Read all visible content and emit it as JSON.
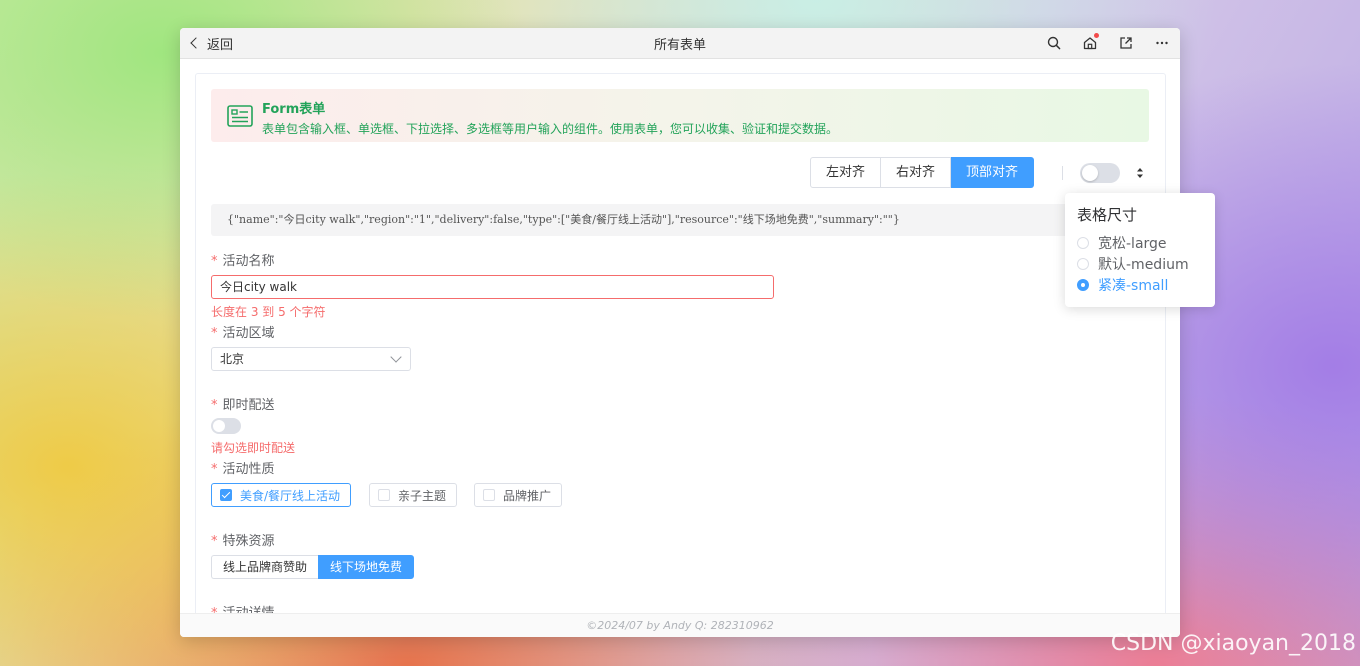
{
  "window": {
    "back_label": "返回",
    "title": "所有表单",
    "icons": [
      "search-icon",
      "home-icon",
      "open-external-icon",
      "more-icon"
    ],
    "notification_dot_color": "#f24b4b"
  },
  "banner": {
    "title": "Form表单",
    "description": "表单包含输入框、单选框、下拉选择、多选框等用户输入的组件。使用表单，您可以收集、验证和提交数据。",
    "icon": "form-icon",
    "color": "#23a35a"
  },
  "align_options": {
    "items": [
      "左对齐",
      "右对齐",
      "顶部对齐"
    ],
    "selected": "顶部对齐"
  },
  "json_preview": "{\"name\":\"今日city walk\",\"region\":\"1\",\"delivery\":false,\"type\":[\"美食/餐厅线上活动\"],\"resource\":\"线下场地免费\",\"summary\":\"\"}",
  "form": {
    "name": {
      "label": "活动名称",
      "value": "今日city walk",
      "error": "长度在 3 到 5 个字符"
    },
    "region": {
      "label": "活动区域",
      "value": "北京"
    },
    "delivery": {
      "label": "即时配送",
      "checked": false,
      "error": "请勾选即时配送"
    },
    "type": {
      "label": "活动性质",
      "options": [
        {
          "label": "美食/餐厅线上活动",
          "checked": true
        },
        {
          "label": "亲子主题",
          "checked": false
        },
        {
          "label": "品牌推广",
          "checked": false
        }
      ]
    },
    "resource": {
      "label": "特殊资源",
      "options": [
        "线上品牌商赞助",
        "线下场地免费"
      ],
      "selected": "线下场地免费"
    },
    "summary": {
      "label": "活动详情"
    },
    "required_mark": "*"
  },
  "footer": "©2024/07 by Andy Q: 282310962",
  "size_popover": {
    "title": "表格尺寸",
    "options": [
      "宽松-large",
      "默认-medium",
      "紧凑-small"
    ],
    "selected": "紧凑-small"
  },
  "theme": {
    "primary": "#409eff",
    "danger": "#f56c6c"
  },
  "watermark": "CSDN @xiaoyan_2018"
}
